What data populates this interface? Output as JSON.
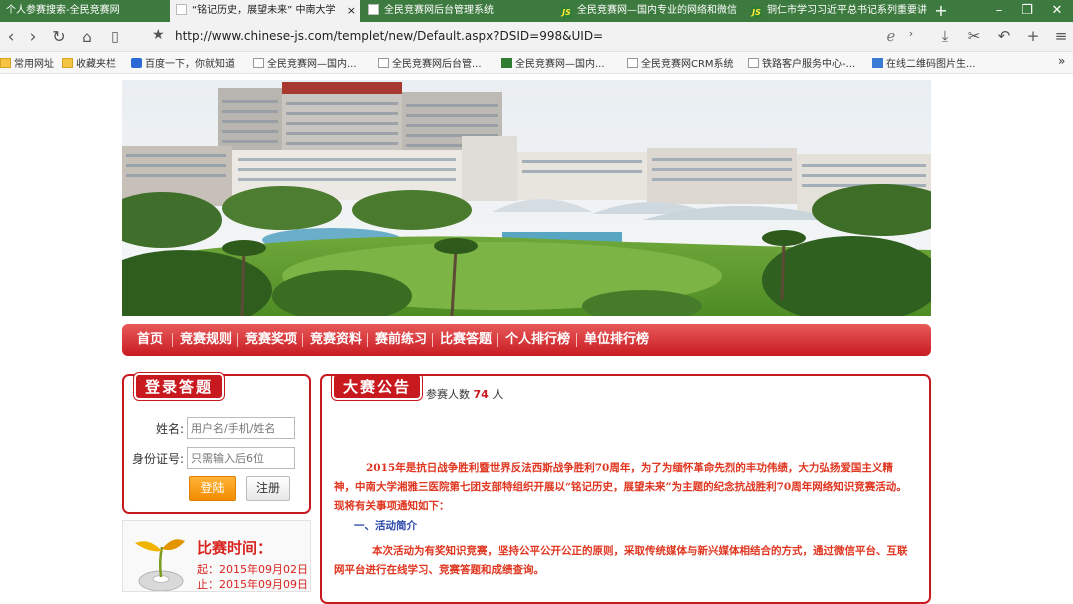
{
  "browser": {
    "tabs": [
      {
        "title": "个人参赛搜索-全民竞赛网",
        "active": false,
        "icon": "none"
      },
      {
        "title": "“铭记历史，展望未来” 中南大学",
        "active": true,
        "icon": "page-icon"
      },
      {
        "title": "全民竞赛网后台管理系统",
        "active": false,
        "icon": "page-icon"
      },
      {
        "title": "全民竞赛网—国内专业的网络和微信",
        "active": false,
        "icon": "js-logo-icon"
      },
      {
        "title": "铜仁市学习习近平总书记系列重要讲",
        "active": false,
        "icon": "js-logo-icon"
      }
    ],
    "new_tab": "+",
    "url": "http://www.chinese-js.com/templet/new/Default.aspx?DSID=998&UID=",
    "bookmarks": [
      {
        "label": "常用网址",
        "icon": "folder-icon"
      },
      {
        "label": "收藏夹栏",
        "icon": "folder-icon"
      },
      {
        "label": "百度一下，你就知道",
        "icon": "baidu-paw-icon"
      },
      {
        "label": "全民竞赛网—国内...",
        "icon": "page-icon"
      },
      {
        "label": "全民竞赛网后台管...",
        "icon": "page-icon"
      },
      {
        "label": "全民竞赛网—国内...",
        "icon": "js-logo-icon"
      },
      {
        "label": "全民竞赛网CRM系统",
        "icon": "page-icon"
      },
      {
        "label": "铁路客户服务中心-...",
        "icon": "page-icon"
      },
      {
        "label": "在线二维码图片生...",
        "icon": "qr-icon"
      }
    ],
    "more": "»"
  },
  "nav": {
    "items": [
      "首页",
      "竞赛规则",
      "竞赛奖项",
      "竞赛资料",
      "赛前练习",
      "比赛答题",
      "个人排行榜",
      "单位排行榜"
    ]
  },
  "login": {
    "title": "登录答题",
    "name_label": "姓名:",
    "name_placeholder": "用户名/手机/姓名",
    "id_label": "身份证号:",
    "id_placeholder": "只需输入后6位",
    "login_button": "登陆",
    "register_button": "注册"
  },
  "contest_time": {
    "title": "比赛时间：",
    "start": "起：2015年09月02日",
    "end": "止：2015年09月09日"
  },
  "notice": {
    "title": "大赛公告",
    "participants_prefix": "参赛人数",
    "participants_count": "74",
    "participants_suffix": "人",
    "intro": "2015年是抗日战争胜利暨世界反法西斯战争胜利70周年，为了为缅怀革命先烈的丰功伟绩，大力弘扬爱国主义精神，中南大学湘雅三医院第七团支部特组织开展以“铭记历史，展望未来”为主题的纪念抗战胜利70周年网络知识竞赛活动。现将有关事项通知如下：",
    "section1_heading": "一、活动简介",
    "section1_text": "本次活动为有奖知识竞赛，坚持公平公开公正的原则，采取传统媒体与新兴媒体相结合的方式，通过微信平台、互联网平台进行在线学习、竞赛答题和成绩查询。"
  },
  "colors": {
    "accent_red": "#c8191f",
    "tab_bar_green": "#3d7a3f",
    "notice_text": "#e0351f",
    "heading_blue": "#2b47a8",
    "login_orange": "#f28c00"
  }
}
